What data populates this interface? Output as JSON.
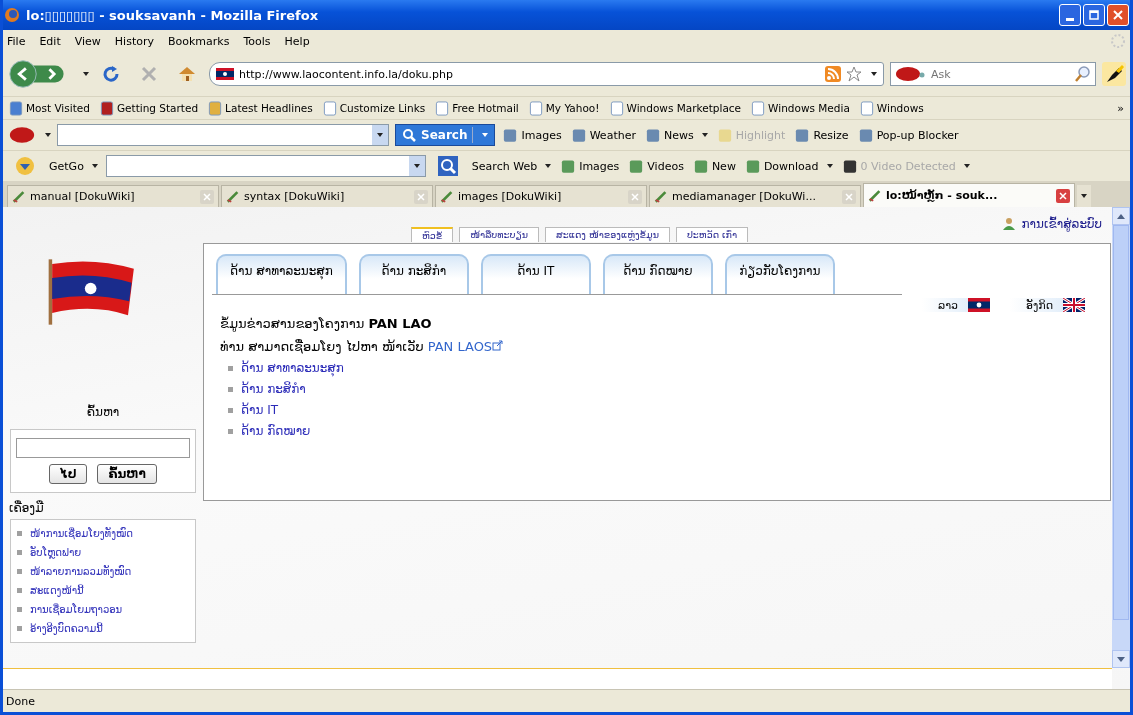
{
  "window": {
    "title": "lo:▯▯▯▯▯▯▯ - souksavanh - Mozilla Firefox"
  },
  "menu": [
    "File",
    "Edit",
    "View",
    "History",
    "Bookmarks",
    "Tools",
    "Help"
  ],
  "navigation": {
    "url": "http://www.laocontent.info.la/doku.php",
    "search_placeholder": "Ask"
  },
  "bookmarks": [
    {
      "label": "Most Visited",
      "kind": "star"
    },
    {
      "label": "Getting Started",
      "kind": "fox"
    },
    {
      "label": "Latest Headlines",
      "kind": "feed"
    },
    {
      "label": "Customize Links",
      "kind": "page"
    },
    {
      "label": "Free Hotmail",
      "kind": "page"
    },
    {
      "label": "My Yahoo!",
      "kind": "page"
    },
    {
      "label": "Windows Marketplace",
      "kind": "page"
    },
    {
      "label": "Windows Media",
      "kind": "page"
    },
    {
      "label": "Windows",
      "kind": "page"
    }
  ],
  "bookmarks_more": "»",
  "ask_toolbar": {
    "search_button": "Search",
    "items": [
      {
        "label": "Images",
        "dropdown": false,
        "disabled": false
      },
      {
        "label": "Weather",
        "dropdown": false,
        "disabled": false
      },
      {
        "label": "News",
        "dropdown": true,
        "disabled": false
      },
      {
        "label": "Highlight",
        "dropdown": false,
        "disabled": true
      },
      {
        "label": "Resize",
        "dropdown": false,
        "disabled": false
      },
      {
        "label": "Pop-up Blocker",
        "dropdown": false,
        "disabled": false
      }
    ]
  },
  "getgo_toolbar": {
    "label": "GetGo",
    "items": [
      {
        "label": "Search Web",
        "dropdown": true,
        "disabled": false
      },
      {
        "label": "Images",
        "dropdown": false,
        "disabled": false
      },
      {
        "label": "Videos",
        "dropdown": false,
        "disabled": false
      },
      {
        "label": "New",
        "dropdown": false,
        "disabled": false
      },
      {
        "label": "Download",
        "dropdown": true,
        "disabled": false
      },
      {
        "label": "0 Video Detected",
        "dropdown": true,
        "disabled": true
      }
    ]
  },
  "browser_tabs": [
    {
      "label": "manual [DokuWiki]",
      "selected": false
    },
    {
      "label": "syntax [DokuWiki]",
      "selected": false
    },
    {
      "label": "images [DokuWiki]",
      "selected": false
    },
    {
      "label": "mediamanager [DokuWi...",
      "selected": false
    },
    {
      "label": "lo:ໜ້າຫຼັກ - souk...",
      "selected": true
    }
  ],
  "page": {
    "login": "ການເຂົ້າສູ່ລະບົບ",
    "top_tabs": [
      {
        "label": "ຫົວຂໍ້",
        "selected": true
      },
      {
        "label": "ໜ້າລືບທະບຽນ",
        "selected": false
      },
      {
        "label": "ສະແດງ ໜ້າຂອງແຫຼ່ງຂໍ້ມູນ",
        "selected": false
      },
      {
        "label": "ປະຫວັດ ເກົ່າ",
        "selected": false
      }
    ],
    "content_tabs": [
      "ດ້ານ ສາທາລະນະສຸກ",
      "ດ້ານ ກະສິກຳ",
      "ດ້ານ IT",
      "ດ້ານ ກົດໝາຍ",
      "ກ່ຽວກັບໂຄງການ"
    ],
    "languages": [
      {
        "label": "ລາວ",
        "kind": "lao"
      },
      {
        "label": "ອັງກິດ",
        "kind": "uk"
      }
    ],
    "heading": "ຂໍ້ມູນຂ່າວສານຂອງໂຄງການ **PAN LAO**",
    "intro": "ທ່ານ ສາມາດເຊື່ອມໂຍງ ໄປຫາ ໜ້າເວັບ",
    "intro_link": "PAN LAOS",
    "links": [
      "ດ້ານ ສາທາລະນະສຸກ",
      "ດ້ານ ກະສິກຳ",
      "ດ້ານ IT",
      "ດ້ານ ກົດໝາຍ"
    ],
    "sidebar": {
      "search_title": "ຄົ້ນຫາ",
      "go_button": "ໄປ",
      "search_button": "ຄົ້ນຫາ",
      "tools_title": "ເຄື່ອງມື",
      "tools": [
        "ໜ້າການເຊື່ອມໂຍງທັງໝົດ",
        "ອັບໂຫຼດຟາຍ",
        "ໜ້າລາຍການລວມທັງໝົດ",
        "ສະແດງໜ້ານີ້",
        "ການເຊື່ອມໂຍມຖາວອນ",
        "ອ້າງອີງບົດຄວາມນີ້"
      ]
    }
  },
  "status_bar": "Done"
}
